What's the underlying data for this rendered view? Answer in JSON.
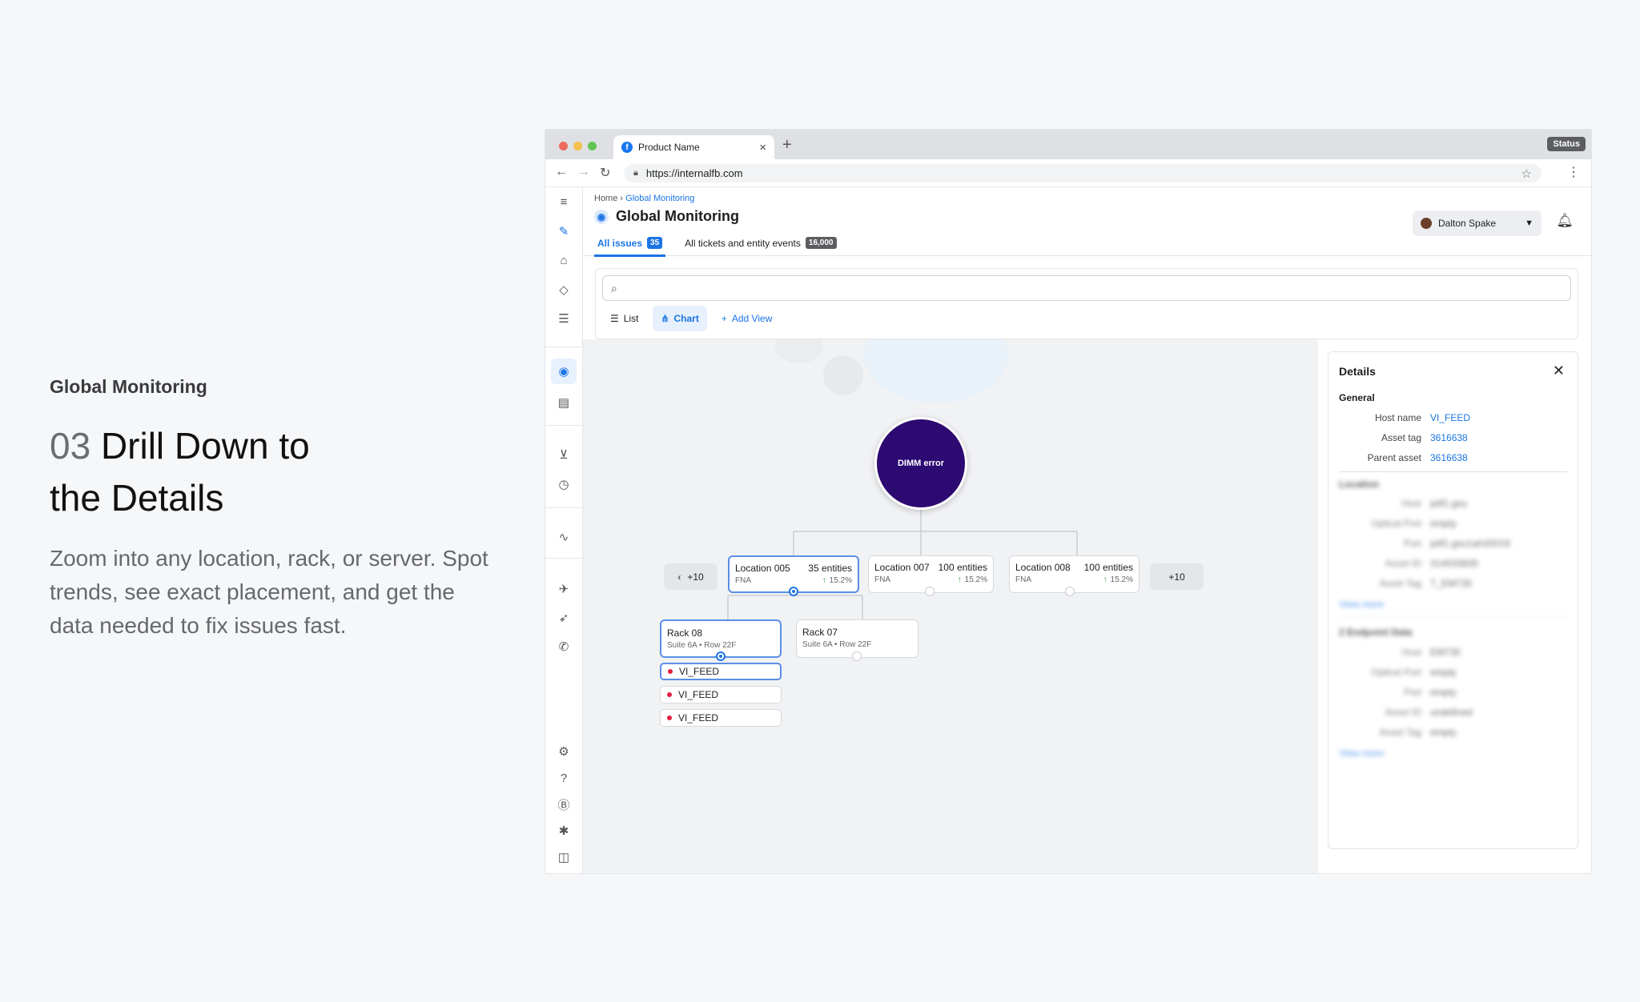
{
  "promo": {
    "eyebrow": "Global Monitoring",
    "number": "03",
    "title_line1": "Drill Down to",
    "title_line2": "the Details",
    "body": "Zoom into any location, rack, or server. Spot trends, see exact placement, and get the data needed to fix issues fast."
  },
  "browser": {
    "tab_title": "Product Name",
    "status_button": "Status",
    "url": "https://internalfb.com"
  },
  "header": {
    "breadcrumb_home": "Home",
    "breadcrumb_current": "Global Monitoring",
    "page_title": "Global Monitoring",
    "tabs": [
      {
        "label": "All issues",
        "count": "35"
      },
      {
        "label": "All tickets and entity events",
        "count": "16,000"
      }
    ],
    "user_name": "Dalton Spake"
  },
  "views": {
    "list": "List",
    "chart": "Chart",
    "add": "Add View"
  },
  "tree": {
    "root": "DIMM error",
    "prev_count": "+10",
    "next_count": "+10",
    "locations": [
      {
        "name": "Location 005",
        "entities": "35 entities",
        "region": "FNA",
        "trend": "15.2%"
      },
      {
        "name": "Location 007",
        "entities": "100 entities",
        "region": "FNA",
        "trend": "15.2%"
      },
      {
        "name": "Location 008",
        "entities": "100 entities",
        "region": "FNA",
        "trend": "15.2%"
      }
    ],
    "racks": [
      {
        "name": "Rack 08",
        "sub": "Suite 6A • Row 22F"
      },
      {
        "name": "Rack 07",
        "sub": "Suite 6A • Row 22F"
      }
    ],
    "hosts": [
      "VI_FEED",
      "VI_FEED",
      "VI_FEED"
    ]
  },
  "details": {
    "title": "Details",
    "general_label": "General",
    "general": [
      {
        "key": "Host name",
        "value": "VI_FEED"
      },
      {
        "key": "Asset tag",
        "value": "3616638"
      },
      {
        "key": "Parent asset",
        "value": "3616638"
      }
    ],
    "location_label": "Location",
    "location_rows": [
      {
        "key": "Host",
        "value": "pdf1.gsu"
      },
      {
        "key": "Optical Port",
        "value": "empty"
      },
      {
        "key": "Port",
        "value": "pdf1.gsu1ah3/0/19"
      },
      {
        "key": "Asset ID",
        "value": "314033835"
      },
      {
        "key": "Asset Tag",
        "value": "T_EM735"
      }
    ],
    "view_more": "View more",
    "endpoint_label": "2 Endpoint Data",
    "endpoint_rows": [
      {
        "key": "Host",
        "value": "EM735"
      },
      {
        "key": "Optical Port",
        "value": "empty"
      },
      {
        "key": "Port",
        "value": "empty"
      },
      {
        "key": "Asset ID",
        "value": "undefined"
      },
      {
        "key": "Asset Tag",
        "value": "empty"
      }
    ],
    "view_more_2": "View more"
  },
  "colors": {
    "accent": "#1b74e4",
    "root_node": "#2d0a72",
    "trend_up": "#31a24c",
    "error_dot": "#e41e3f"
  },
  "icons": [
    "menu-icon",
    "magic-wand-icon",
    "home-icon",
    "tag-icon",
    "list-icon",
    "globe-icon",
    "book-icon",
    "cart-icon",
    "history-icon",
    "trend-icon",
    "plane-icon",
    "rocket-icon",
    "phone-icon",
    "gear-icon",
    "help-icon",
    "bitcoin-icon",
    "bug-icon",
    "panel-toggle-icon"
  ]
}
